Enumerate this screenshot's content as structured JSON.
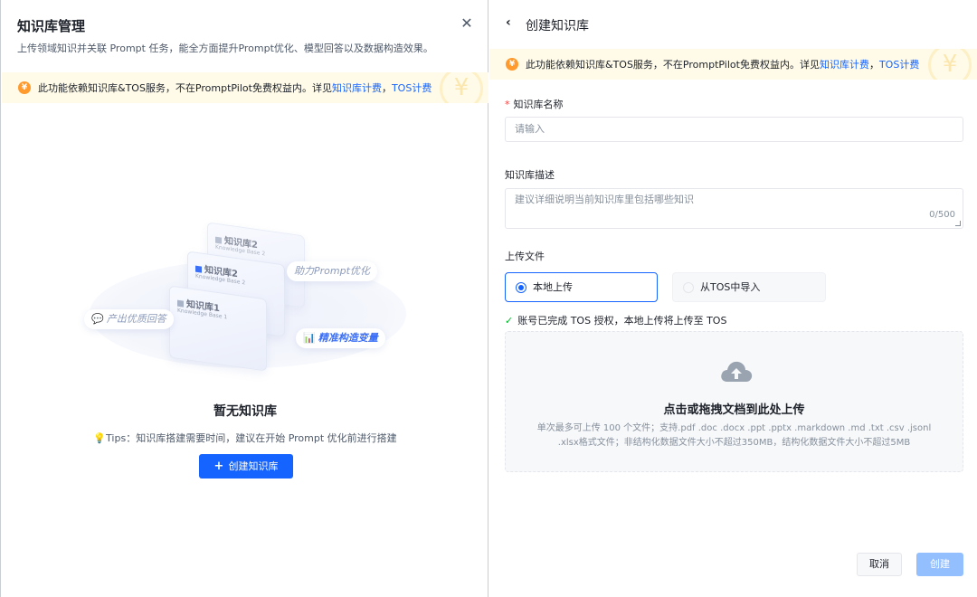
{
  "left_panel": {
    "title": "知识库管理",
    "subtitle": "上传领域知识并关联 Prompt 任务，能全方面提升Prompt优化、模型回答以及数据构造效果。",
    "close_icon": "close-icon",
    "notice": {
      "text": "此功能依赖知识库&TOS服务，不在PromptPilot免费权益内。详见",
      "link1": "知识库计费",
      "separator": "，",
      "link2": "TOS计费",
      "icon": "yen-coin-icon"
    },
    "illustration": {
      "card_back": {
        "title": "知识库2",
        "subtitle": "Knowledge Base 2"
      },
      "card_mid": {
        "title": "知识库2",
        "subtitle": "Knowledge Base 2"
      },
      "card_front": {
        "title": "知识库1",
        "subtitle": "Knowledge Base 1"
      },
      "tag_boost": "助力Prompt优化",
      "tag_answer": "产出优质回答",
      "tag_variable": "精准构造变量"
    },
    "empty_title": "暂无知识库",
    "tips": "Tips：知识库搭建需要时间，建议在开始 Prompt 优化前进行搭建",
    "create_button": "创建知识库"
  },
  "right_panel": {
    "back_icon": "chevron-left-icon",
    "title": "创建知识库",
    "notice": {
      "text": "此功能依赖知识库&TOS服务，不在PromptPilot免费权益内。详见",
      "link1": "知识库计费",
      "separator": "，",
      "link2": "TOS计费"
    },
    "name_field": {
      "label": "知识库名称",
      "required_mark": "*",
      "placeholder": "请输入"
    },
    "desc_field": {
      "label": "知识库描述",
      "placeholder": "建议详细说明当前知识库里包括哪些知识",
      "counter": "0/500"
    },
    "upload_section": {
      "label": "上传文件",
      "options": [
        {
          "label": "本地上传",
          "selected": true
        },
        {
          "label": "从TOS中导入",
          "selected": false
        }
      ],
      "auth_status": "账号已完成 TOS 授权，本地上传将上传至 TOS",
      "dropzone_title": "点击或拖拽文档到此处上传",
      "dropzone_desc": "单次最多可上传 100 个文件；支持.pdf .doc .docx .ppt .pptx .markdown .md .txt .csv .jsonl .xlsx格式文件；非结构化数据文件大小不超过350MB，结构化数据文件大小不超过5MB",
      "dropzone_icon": "cloud-upload-icon"
    },
    "buttons": {
      "cancel": "取消",
      "submit": "创建"
    }
  },
  "colors": {
    "primary": "#1664ff",
    "notice_bg": "#fffbe8",
    "coin": "#ff9a2e",
    "disabled_primary": "#94bfff",
    "success": "#00b42a",
    "required": "#f53f3f"
  }
}
